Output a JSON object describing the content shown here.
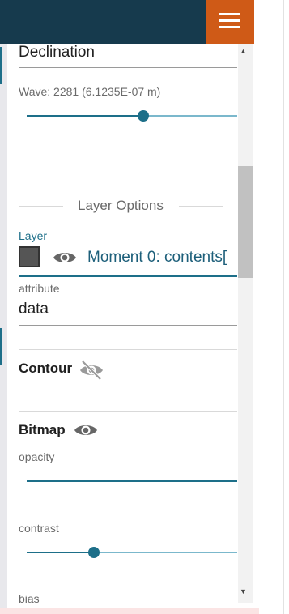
{
  "topbar": {
    "menu_icon": "hamburger-menu-icon",
    "color": "#163a4d",
    "menu_color": "#cf5a17"
  },
  "fields": {
    "declination": {
      "value": "Declination"
    },
    "wave": {
      "label": "Wave: 2281 (6.1235E-07 m)",
      "slider_fraction": 0.5
    }
  },
  "layer_options": {
    "heading": "Layer Options",
    "layer_label": "Layer",
    "layer_value": "Moment 0: contents[",
    "swatch_color": "#555555",
    "attribute_label": "attribute",
    "attribute_value": "data"
  },
  "contour": {
    "title": "Contour",
    "icon": "eye-off-icon"
  },
  "bitmap": {
    "title": "Bitmap",
    "icon": "eye-icon",
    "opacity_label": "opacity",
    "opacity_fraction": 1.0,
    "contrast_label": "contrast",
    "contrast_fraction": 0.32,
    "bias_label": "bias"
  },
  "scrollbar": {
    "up_icon": "scroll-up-arrow-icon",
    "down_icon": "scroll-down-arrow-icon"
  }
}
